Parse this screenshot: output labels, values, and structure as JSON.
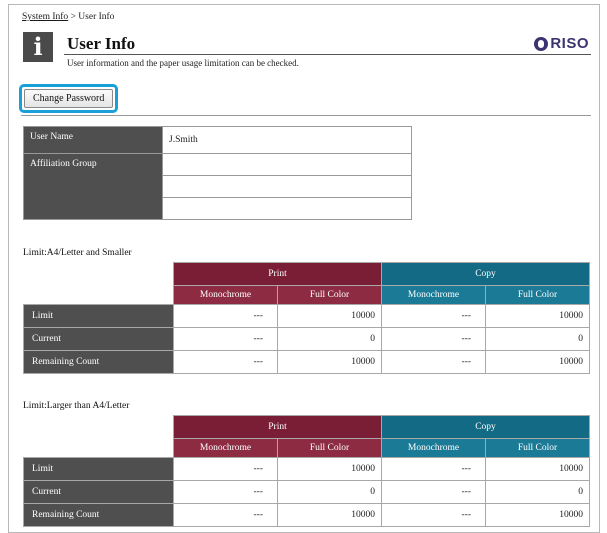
{
  "breadcrumb": {
    "parent": "System Info",
    "separator": " > ",
    "current": "User Info"
  },
  "header": {
    "icon_char": "i",
    "title": "User Info",
    "subtitle": "User information and the paper usage limitation can be checked.",
    "logo_text": "RISO"
  },
  "actions": {
    "change_password": "Change Password"
  },
  "user": {
    "name_label": "User Name",
    "name_value": "J.Smith",
    "group_label": "Affiliation Group",
    "groups": [
      "",
      "",
      ""
    ]
  },
  "sections": [
    {
      "label": "Limit:A4/Letter and Smaller",
      "print_header": "Print",
      "copy_header": "Copy",
      "sub_headers": [
        "Monochrome",
        "Full Color",
        "Monochrome",
        "Full Color"
      ],
      "rows": [
        {
          "label": "Limit",
          "values": [
            "---",
            "10000",
            "---",
            "10000"
          ]
        },
        {
          "label": "Current",
          "values": [
            "---",
            "0",
            "---",
            "0"
          ]
        },
        {
          "label": "Remaining Count",
          "values": [
            "---",
            "10000",
            "---",
            "10000"
          ]
        }
      ]
    },
    {
      "label": "Limit:Larger than A4/Letter",
      "print_header": "Print",
      "copy_header": "Copy",
      "sub_headers": [
        "Monochrome",
        "Full Color",
        "Monochrome",
        "Full Color"
      ],
      "rows": [
        {
          "label": "Limit",
          "values": [
            "---",
            "10000",
            "---",
            "10000"
          ]
        },
        {
          "label": "Current",
          "values": [
            "---",
            "0",
            "---",
            "0"
          ]
        },
        {
          "label": "Remaining Count",
          "values": [
            "---",
            "10000",
            "---",
            "10000"
          ]
        }
      ]
    }
  ],
  "colors": {
    "print": "#7a1e35",
    "copy": "#126a84",
    "label_bg": "#4f4f4f",
    "highlight": "#1aa0d8"
  }
}
